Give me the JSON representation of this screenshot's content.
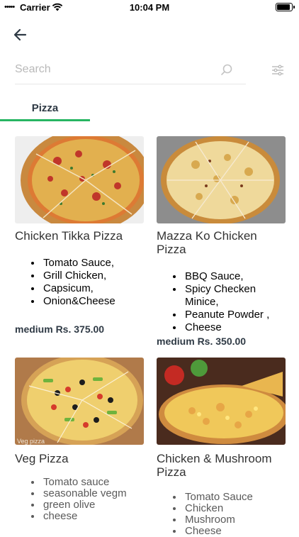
{
  "status_bar": {
    "carrier": "Carrier",
    "time": "10:04 PM"
  },
  "search": {
    "placeholder": "Search"
  },
  "tabs": [
    {
      "label": "Pizza"
    }
  ],
  "cards": [
    {
      "title": "Chicken Tikka Pizza",
      "ingredients": [
        "Tomato Sauce,",
        "Grill Chicken,",
        "Capsicum,",
        "Onion&Cheese"
      ],
      "price": "medium Rs. 375.00"
    },
    {
      "title": "Mazza Ko Chicken Pizza",
      "ingredients": [
        "BBQ Sauce,",
        "Spicy Checken Minice,",
        "Peanute Powder ,",
        "Cheese"
      ],
      "price": "medium Rs. 350.00"
    },
    {
      "title": "Veg Pizza",
      "image_caption": "Veg pizza",
      "ingredients": [
        "Tomato sauce",
        "seasonable vegm",
        "green olive",
        "cheese"
      ]
    },
    {
      "title": "Chicken & Mushroom Pizza",
      "ingredients": [
        "Tomato Sauce",
        "Chicken",
        "Mushroom",
        "Cheese"
      ]
    }
  ]
}
